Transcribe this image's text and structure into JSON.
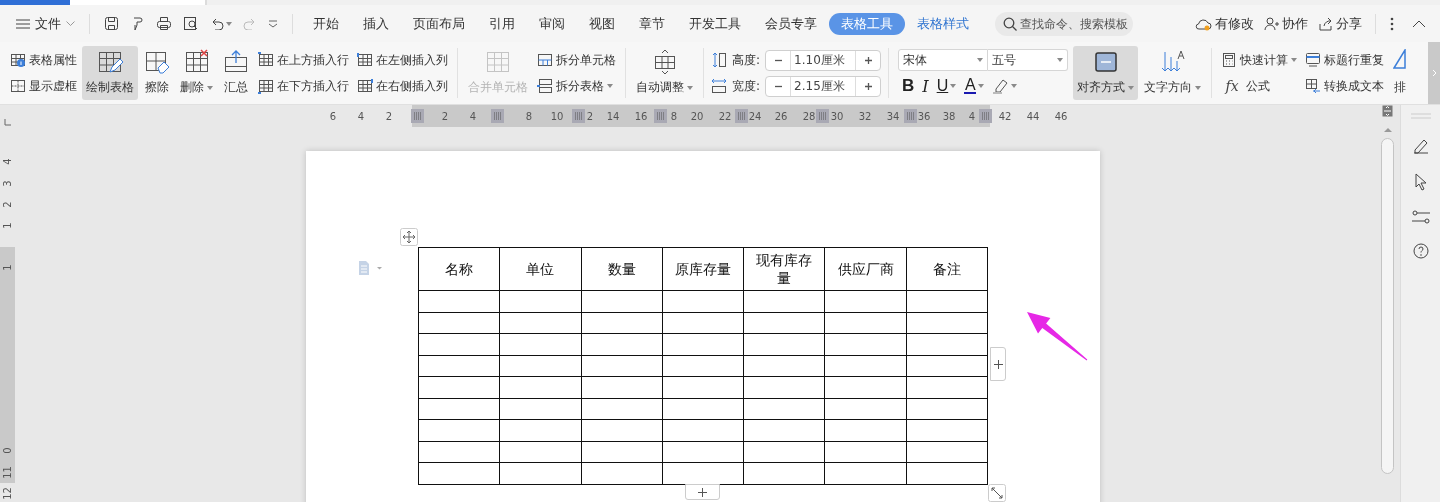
{
  "menu_bar": {
    "file_menu": "文件",
    "tabs": [
      {
        "label": "开始",
        "selected": false,
        "contextual": false
      },
      {
        "label": "插入",
        "selected": false,
        "contextual": false
      },
      {
        "label": "页面布局",
        "selected": false,
        "contextual": false
      },
      {
        "label": "引用",
        "selected": false,
        "contextual": false
      },
      {
        "label": "审阅",
        "selected": false,
        "contextual": false
      },
      {
        "label": "视图",
        "selected": false,
        "contextual": false
      },
      {
        "label": "章节",
        "selected": false,
        "contextual": false
      },
      {
        "label": "开发工具",
        "selected": false,
        "contextual": false
      },
      {
        "label": "会员专享",
        "selected": false,
        "contextual": false
      },
      {
        "label": "表格工具",
        "selected": true,
        "contextual": true
      },
      {
        "label": "表格样式",
        "selected": false,
        "contextual": true
      }
    ],
    "search": {
      "placeholder": "查找命令、搜索模板"
    },
    "actions": [
      {
        "label": "有修改"
      },
      {
        "label": "协作"
      },
      {
        "label": "分享"
      }
    ]
  },
  "ribbon": {
    "groups": [
      [
        {
          "kind": "stack",
          "items": [
            {
              "label": "表格属性",
              "dropdown": false
            },
            {
              "label": "显示虚框",
              "dropdown": false
            }
          ]
        },
        {
          "kind": "large",
          "label": "绘制表格",
          "selected": true,
          "disabled": false,
          "dropdown": false
        },
        {
          "kind": "large",
          "label": "擦除",
          "selected": false,
          "disabled": false,
          "dropdown": false
        },
        {
          "kind": "large",
          "label": "删除",
          "selected": false,
          "disabled": false,
          "dropdown": true
        },
        {
          "kind": "large",
          "label": "汇总",
          "selected": false,
          "disabled": false,
          "dropdown": false
        },
        {
          "kind": "stack",
          "items": [
            {
              "label": "在上方插入行",
              "dropdown": false
            },
            {
              "label": "在下方插入行",
              "dropdown": false
            }
          ]
        },
        {
          "kind": "stack",
          "items": [
            {
              "label": "在左侧插入列",
              "dropdown": false
            },
            {
              "label": "在右侧插入列",
              "dropdown": false
            }
          ]
        }
      ],
      [
        {
          "kind": "large",
          "label": "合并单元格",
          "selected": false,
          "disabled": true,
          "dropdown": false
        },
        {
          "kind": "stack",
          "items": [
            {
              "label": "拆分单元格",
              "dropdown": false
            },
            {
              "label": "拆分表格",
              "dropdown": true
            }
          ]
        }
      ],
      [
        {
          "kind": "large",
          "label": "自动调整",
          "selected": false,
          "disabled": false,
          "dropdown": true
        }
      ],
      [
        {
          "kind": "spin",
          "items": [
            {
              "label": "高度:",
              "value": "1.10厘米"
            },
            {
              "label": "宽度:",
              "value": "2.15厘米"
            }
          ]
        }
      ],
      [
        {
          "kind": "font",
          "font_name": "宋体",
          "font_size": "五号",
          "buttons": [
            {
              "kind": "bold",
              "label": "B",
              "dropdown": false
            },
            {
              "kind": "italic",
              "label": "I",
              "dropdown": false
            },
            {
              "kind": "underline",
              "label": "U",
              "dropdown": true
            },
            {
              "kind": "font_color",
              "label": "A",
              "dropdown": true
            },
            {
              "kind": "highlight",
              "dropdown": true
            }
          ]
        },
        {
          "kind": "large",
          "label": "对齐方式",
          "selected": true,
          "disabled": false,
          "dropdown": true
        },
        {
          "kind": "large",
          "label": "文字方向",
          "selected": false,
          "disabled": false,
          "dropdown": true
        }
      ],
      [
        {
          "kind": "stack",
          "items": [
            {
              "label": "快速计算",
              "dropdown": true
            },
            {
              "label": "公式",
              "icon_text": "fx",
              "dropdown": false
            }
          ]
        },
        {
          "kind": "stack",
          "items": [
            {
              "label": "标题行重复",
              "dropdown": false
            },
            {
              "label": "转换成文本",
              "dropdown": false
            }
          ]
        },
        {
          "kind": "large",
          "label": "排",
          "selected": false,
          "disabled": false,
          "dropdown": false
        }
      ]
    ]
  },
  "ruler": {
    "horizontal": [
      "6",
      "4",
      "2",
      "2",
      "4",
      "8",
      "10",
      "2",
      "14",
      "16",
      "8",
      "20",
      "22",
      "24",
      "26",
      "28",
      "30",
      "32",
      "34",
      "36",
      "38",
      "4",
      "42",
      "44",
      "46"
    ],
    "vertical": [
      "4",
      "3",
      "2",
      "1",
      "1",
      "0",
      "11",
      "12"
    ]
  },
  "table": {
    "columns": [
      "名称",
      "单位",
      "数量",
      "原库存量",
      "现有库存量",
      "供应厂商",
      "备注"
    ],
    "rows": [
      {},
      {},
      {},
      {},
      {},
      {},
      {},
      {},
      {}
    ]
  }
}
